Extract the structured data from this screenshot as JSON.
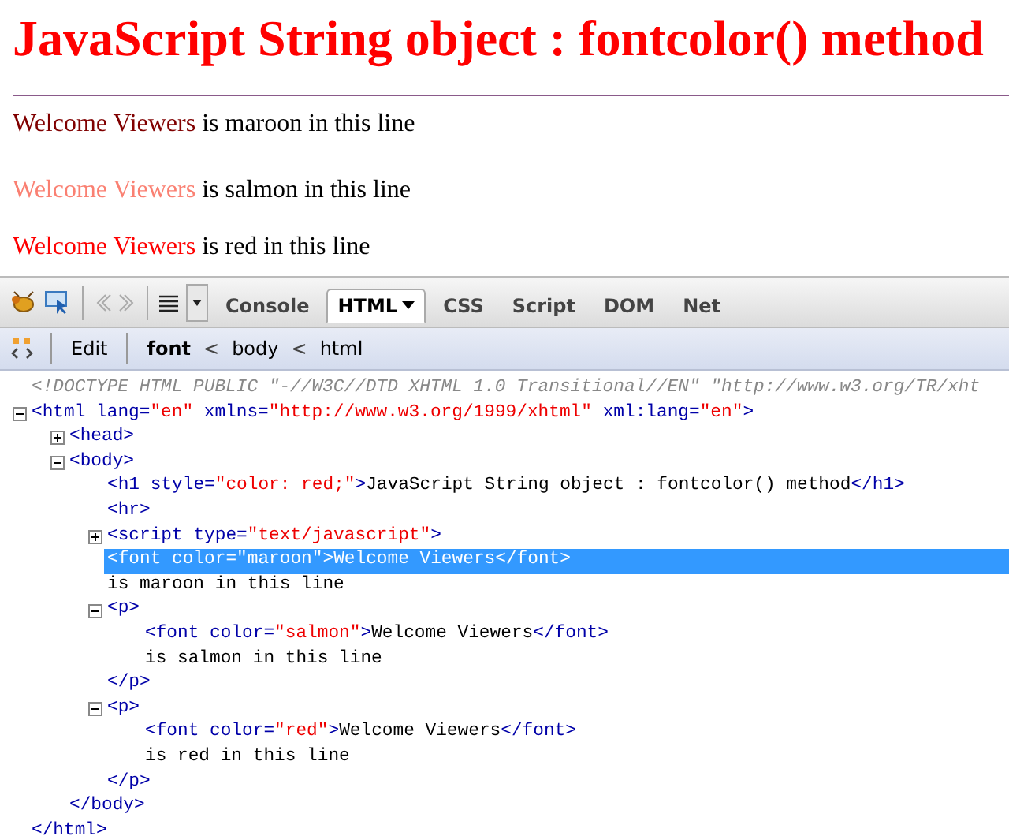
{
  "page": {
    "heading": "JavaScript String object : fontcolor() method",
    "lines": [
      {
        "colored": "Welcome Viewers",
        "color": "#800000",
        "rest": " is maroon in this line"
      },
      {
        "colored": "Welcome Viewers",
        "color": "#fa8072",
        "rest": " is salmon in this line"
      },
      {
        "colored": "Welcome Viewers",
        "color": "#ff0000",
        "rest": " is red in this line"
      }
    ]
  },
  "toolbar": {
    "tabs": [
      {
        "label": "Console",
        "selected": false
      },
      {
        "label": "HTML",
        "selected": true
      },
      {
        "label": "CSS",
        "selected": false
      },
      {
        "label": "Script",
        "selected": false
      },
      {
        "label": "DOM",
        "selected": false
      },
      {
        "label": "Net",
        "selected": false
      }
    ]
  },
  "breadcrumb_bar": {
    "edit": "Edit",
    "separator": "<",
    "items": [
      {
        "label": "font",
        "selected": true
      },
      {
        "label": "body",
        "selected": false
      },
      {
        "label": "html",
        "selected": false
      }
    ]
  },
  "source": {
    "doctype": "<!DOCTYPE HTML PUBLIC \"-//W3C//DTD XHTML 1.0 Transitional//EN\" \"http://www.w3.org/TR/xht",
    "nodes": [
      {
        "expanded": true,
        "selected": false,
        "parts": [
          {
            "kind": "tag",
            "text": "<html"
          },
          {
            "kind": "attr",
            "text": " lang="
          },
          {
            "kind": "value",
            "text": "\"en\""
          },
          {
            "kind": "attr",
            "text": " xmlns="
          },
          {
            "kind": "value",
            "text": "\"http://www.w3.org/1999/xhtml\""
          },
          {
            "kind": "attr",
            "text": " xml:lang="
          },
          {
            "kind": "value",
            "text": "\"en\""
          },
          {
            "kind": "tag",
            "text": ">"
          }
        ],
        "close": "</html>",
        "children": [
          {
            "expanded": false,
            "selected": false,
            "parts": [
              {
                "kind": "tag",
                "text": "<head>"
              }
            ]
          },
          {
            "expanded": true,
            "selected": false,
            "parts": [
              {
                "kind": "tag",
                "text": "<body>"
              }
            ],
            "close": "</body>",
            "children": [
              {
                "selected": false,
                "parts": [
                  {
                    "kind": "tag",
                    "text": "<h1"
                  },
                  {
                    "kind": "attr",
                    "text": " style="
                  },
                  {
                    "kind": "value",
                    "text": "\"color: red;\""
                  },
                  {
                    "kind": "tag",
                    "text": ">"
                  },
                  {
                    "kind": "text",
                    "text": "JavaScript String object : fontcolor() method"
                  },
                  {
                    "kind": "tag",
                    "text": "</h1>"
                  }
                ]
              },
              {
                "selected": false,
                "parts": [
                  {
                    "kind": "tag",
                    "text": "<hr>"
                  }
                ]
              },
              {
                "expanded": false,
                "selected": false,
                "parts": [
                  {
                    "kind": "tag",
                    "text": "<script"
                  },
                  {
                    "kind": "attr",
                    "text": " type="
                  },
                  {
                    "kind": "value",
                    "text": "\"text/javascript\""
                  },
                  {
                    "kind": "tag",
                    "text": ">"
                  }
                ]
              },
              {
                "selected": true,
                "parts": [
                  {
                    "kind": "tag",
                    "text": "<font"
                  },
                  {
                    "kind": "attr",
                    "text": " color="
                  },
                  {
                    "kind": "value",
                    "text": "\"maroon\""
                  },
                  {
                    "kind": "tag",
                    "text": ">"
                  },
                  {
                    "kind": "text",
                    "text": "Welcome Viewers"
                  },
                  {
                    "kind": "tag",
                    "text": "</font>"
                  }
                ]
              },
              {
                "selected": false,
                "parts": [
                  {
                    "kind": "text",
                    "text": "is maroon in this line"
                  }
                ]
              },
              {
                "expanded": true,
                "selected": false,
                "parts": [
                  {
                    "kind": "tag",
                    "text": "<p>"
                  }
                ],
                "close": "</p>",
                "children": [
                  {
                    "selected": false,
                    "parts": [
                      {
                        "kind": "tag",
                        "text": "<font"
                      },
                      {
                        "kind": "attr",
                        "text": " color="
                      },
                      {
                        "kind": "value",
                        "text": "\"salmon\""
                      },
                      {
                        "kind": "tag",
                        "text": ">"
                      },
                      {
                        "kind": "text",
                        "text": "Welcome Viewers"
                      },
                      {
                        "kind": "tag",
                        "text": "</font>"
                      }
                    ]
                  },
                  {
                    "selected": false,
                    "parts": [
                      {
                        "kind": "text",
                        "text": "is salmon in this line"
                      }
                    ]
                  }
                ]
              },
              {
                "expanded": true,
                "selected": false,
                "parts": [
                  {
                    "kind": "tag",
                    "text": "<p>"
                  }
                ],
                "close": "</p>",
                "children": [
                  {
                    "selected": false,
                    "parts": [
                      {
                        "kind": "tag",
                        "text": "<font"
                      },
                      {
                        "kind": "attr",
                        "text": " color="
                      },
                      {
                        "kind": "value",
                        "text": "\"red\""
                      },
                      {
                        "kind": "tag",
                        "text": ">"
                      },
                      {
                        "kind": "text",
                        "text": "Welcome Viewers"
                      },
                      {
                        "kind": "tag",
                        "text": "</font>"
                      }
                    ]
                  },
                  {
                    "selected": false,
                    "parts": [
                      {
                        "kind": "text",
                        "text": "is red in this line"
                      }
                    ]
                  }
                ]
              }
            ]
          }
        ]
      }
    ]
  }
}
